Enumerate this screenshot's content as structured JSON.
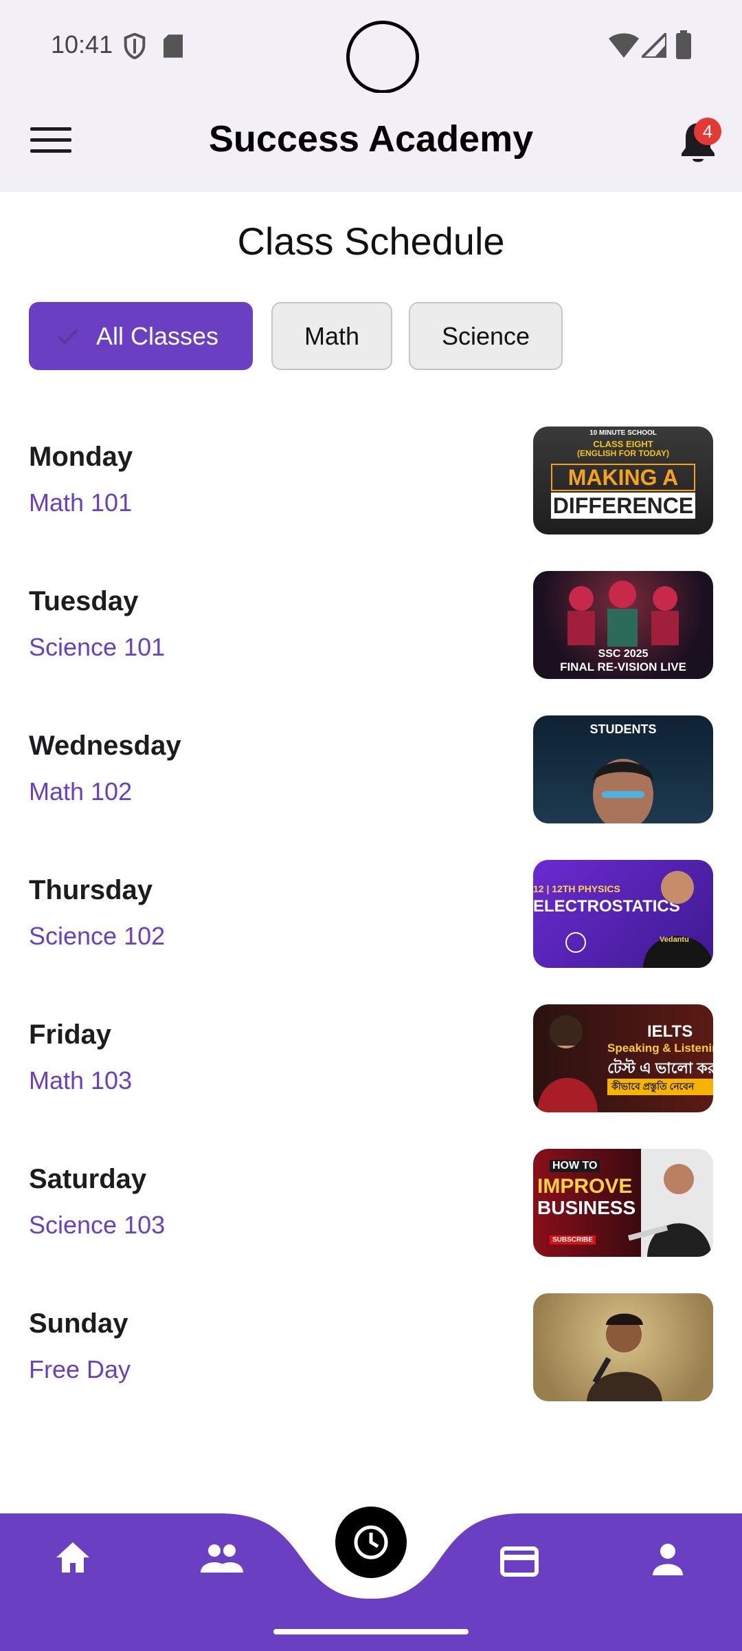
{
  "status_bar": {
    "time": "10:41"
  },
  "app_bar": {
    "title": "Success Academy",
    "notification_count": "4"
  },
  "page": {
    "heading": "Class Schedule"
  },
  "filters": [
    {
      "label": "All Classes",
      "selected": true
    },
    {
      "label": "Math",
      "selected": false
    },
    {
      "label": "Science",
      "selected": false
    }
  ],
  "schedule": [
    {
      "day": "Monday",
      "course": "Math 101",
      "thumbnail": {
        "lines": [
          "10 MINUTE SCHOOL",
          "CLASS EIGHT",
          "(ENGLISH FOR TODAY)",
          "MAKING A",
          "DIFFERENCE"
        ]
      }
    },
    {
      "day": "Tuesday",
      "course": "Science 101",
      "thumbnail": {
        "lines": [
          "SSC 2025",
          "FINAL RE-VISION LIVE"
        ]
      }
    },
    {
      "day": "Wednesday",
      "course": "Math 102",
      "thumbnail": {
        "lines": [
          "STUDENTS"
        ]
      }
    },
    {
      "day": "Thursday",
      "course": "Science 102",
      "thumbnail": {
        "lines": [
          "12 | 12TH PHYSICS",
          "ELECTROSTATICS",
          "Vedantu"
        ]
      }
    },
    {
      "day": "Friday",
      "course": "Math 103",
      "thumbnail": {
        "lines": [
          "IELTS",
          "Speaking & Listening",
          "টেস্ট এ ভালো কর",
          "কীভাবে প্রস্তুতি নেবেন"
        ]
      }
    },
    {
      "day": "Saturday",
      "course": "Science 103",
      "thumbnail": {
        "lines": [
          "HOW TO",
          "IMPROVE",
          "BUSINESS",
          "SUBSCRIBE"
        ]
      }
    },
    {
      "day": "Sunday",
      "course": "Free Day",
      "thumbnail": {
        "lines": []
      }
    }
  ],
  "bottom_nav": {
    "items": [
      "home-icon",
      "people-icon",
      "schedule-clock-icon",
      "payment-card-icon",
      "profile-icon"
    ]
  },
  "colors": {
    "primary": "#6a3fc1",
    "nav_background": "#6a3fc1",
    "app_bar": "#f3eff6",
    "badge": "#e53935"
  }
}
